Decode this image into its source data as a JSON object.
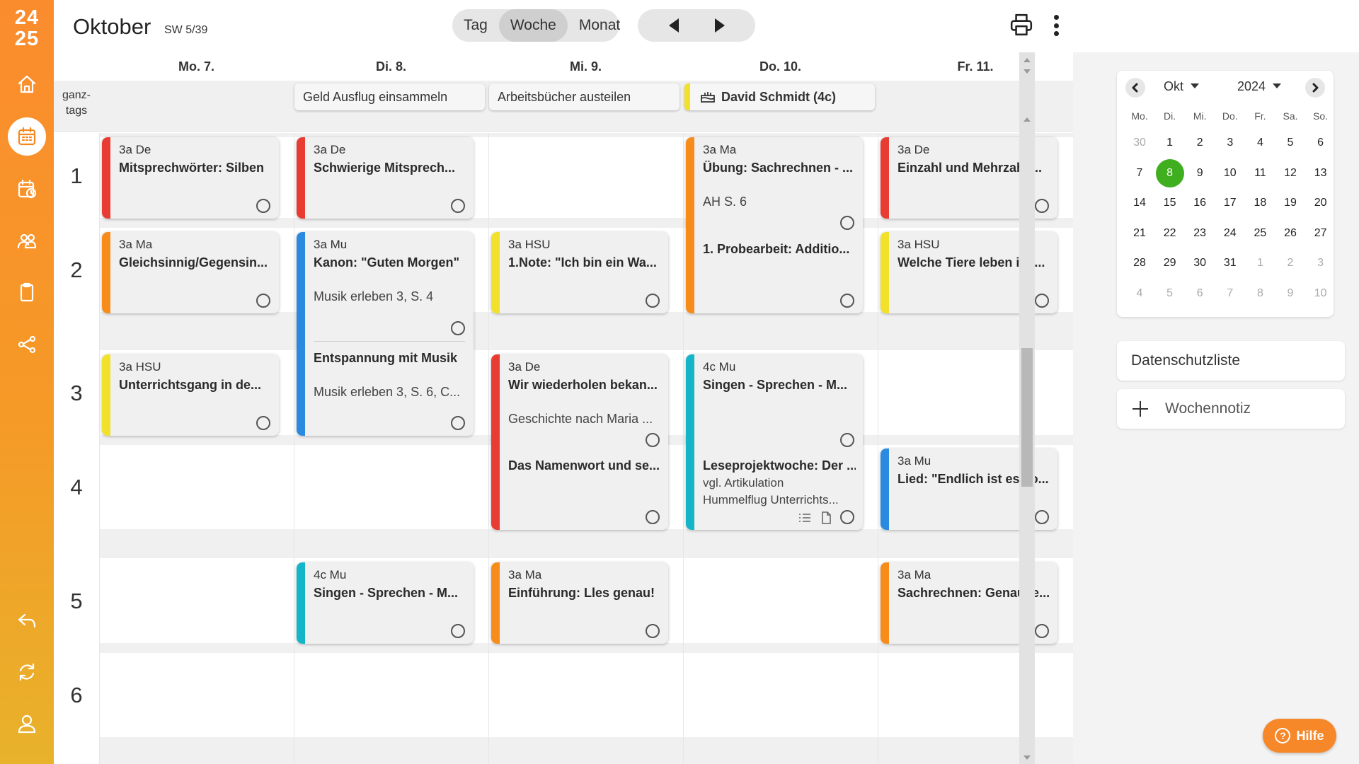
{
  "sidebar": {
    "logo_top": "24",
    "logo_bottom": "25",
    "items": [
      {
        "icon": "home-icon"
      },
      {
        "icon": "calendar-icon",
        "active": true
      },
      {
        "icon": "calendar-check-icon"
      },
      {
        "icon": "users-icon"
      },
      {
        "icon": "clipboard-icon"
      },
      {
        "icon": "share-icon"
      },
      {
        "icon": "reply-icon"
      },
      {
        "icon": "sync-icon"
      },
      {
        "icon": "user-icon"
      }
    ]
  },
  "header": {
    "month": "Oktober",
    "week": "SW 5/39",
    "views": [
      "Tag",
      "Woche",
      "Monat"
    ],
    "active_view": "Woche"
  },
  "days": [
    "Mo. 7.",
    "Di. 8.",
    "Mi. 9.",
    "Do. 10.",
    "Fr. 11."
  ],
  "allday_label_1": "ganz-",
  "allday_label_2": "tags",
  "allday_events": [
    {
      "day": 1,
      "text": "Geld Ausflug einsammeln"
    },
    {
      "day": 2,
      "text": "Arbeitsbücher austeilen"
    },
    {
      "day": 3,
      "text": "David Schmidt (4c)",
      "type": "birthday",
      "color": "#f2e12a"
    }
  ],
  "periods": [
    "1",
    "2",
    "3",
    "4",
    "5",
    "6"
  ],
  "colors": {
    "De": "#e83b32",
    "Ma": "#f78c1a",
    "HSU": "#f2e12a",
    "Mu": "#2a8ae0",
    "Mu4c": "#14b5c8",
    "today": "#3fae1f",
    "accent": "#f7882a"
  },
  "events": [
    {
      "id": "mo1",
      "class": "3a De",
      "title": "Mitsprechwörter: Silben"
    },
    {
      "id": "mo2",
      "class": "3a Ma",
      "title": "Gleichsinnig/Gegensin..."
    },
    {
      "id": "mo3",
      "class": "3a HSU",
      "title": "Unterrichtsgang in de..."
    },
    {
      "id": "di1",
      "class": "3a De",
      "title": "Schwierige Mitsprech..."
    },
    {
      "id": "di2",
      "class": "3a Mu",
      "title": "Kanon: \"Guten Morgen\"",
      "sub": "Musik erleben 3, S. 4",
      "title2": "Entspannung mit Musik",
      "sub2": "Musik erleben 3, S. 6, C..."
    },
    {
      "id": "di5",
      "class": "4c Mu",
      "title": "Singen - Sprechen - M..."
    },
    {
      "id": "mi2",
      "class": "3a HSU",
      "title": "1.Note: \"Ich bin ein Wa..."
    },
    {
      "id": "mi3",
      "class": "3a De",
      "title": "Wir wiederholen bekan...",
      "sub": "Geschichte nach Maria ...",
      "title2": "Das Namenwort und se..."
    },
    {
      "id": "mi5",
      "class": "3a Ma",
      "title": "Einführung: Lles genau!"
    },
    {
      "id": "do1",
      "class": "3a Ma",
      "title": "Übung: Sachrechnen - ...",
      "sub": "AH S. 6",
      "title2": "1. Probearbeit: Additio..."
    },
    {
      "id": "do3",
      "class": "4c Mu",
      "title": "Singen - Sprechen - M...",
      "title2": "Leseprojektwoche: Der ...",
      "sub2": "vgl. Artikulation",
      "sub3": "Hummelflug Unterrichts..."
    },
    {
      "id": "fr1",
      "class": "3a De",
      "title": "Einzahl und Mehrzahl ..."
    },
    {
      "id": "fr2",
      "class": "3a HSU",
      "title": "Welche Tiere leben im ..."
    },
    {
      "id": "fr4",
      "class": "3a Mu",
      "title": "Lied: \"Endlich ist es so..."
    },
    {
      "id": "fr5",
      "class": "3a Ma",
      "title": "Sachrechnen: Genau le..."
    }
  ],
  "minical": {
    "month": "Okt",
    "year": "2024",
    "weekdays": [
      "Mo.",
      "Di.",
      "Mi.",
      "Do.",
      "Fr.",
      "Sa.",
      "So."
    ],
    "weeks": [
      [
        "30",
        "1",
        "2",
        "3",
        "4",
        "5",
        "6"
      ],
      [
        "7",
        "8",
        "9",
        "10",
        "11",
        "12",
        "13"
      ],
      [
        "14",
        "15",
        "16",
        "17",
        "18",
        "19",
        "20"
      ],
      [
        "21",
        "22",
        "23",
        "24",
        "25",
        "26",
        "27"
      ],
      [
        "28",
        "29",
        "30",
        "31",
        "1",
        "2",
        "3"
      ],
      [
        "4",
        "5",
        "6",
        "7",
        "8",
        "9",
        "10"
      ]
    ],
    "today": "8"
  },
  "datenschutz": "Datenschutzliste",
  "wochennotiz": "Wochennotiz",
  "help": "Hilfe"
}
